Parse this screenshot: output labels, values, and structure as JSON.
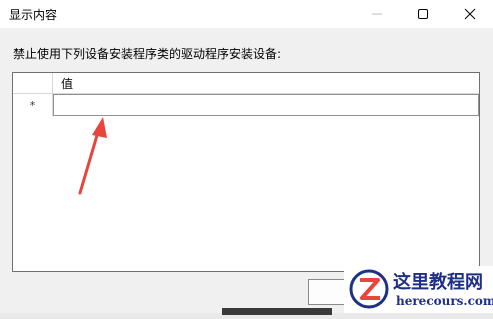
{
  "window": {
    "title": "显示内容"
  },
  "dialog": {
    "instruction": "禁止使用下列设备安装程序类的驱动程序安装设备:",
    "table": {
      "column_header": "值",
      "new_row_marker": "*"
    }
  },
  "watermark": {
    "name": "这里教程网",
    "url": "herecours.com"
  },
  "colors": {
    "annotation_arrow": "#e8453c",
    "watermark_text": "#1f2f86"
  }
}
